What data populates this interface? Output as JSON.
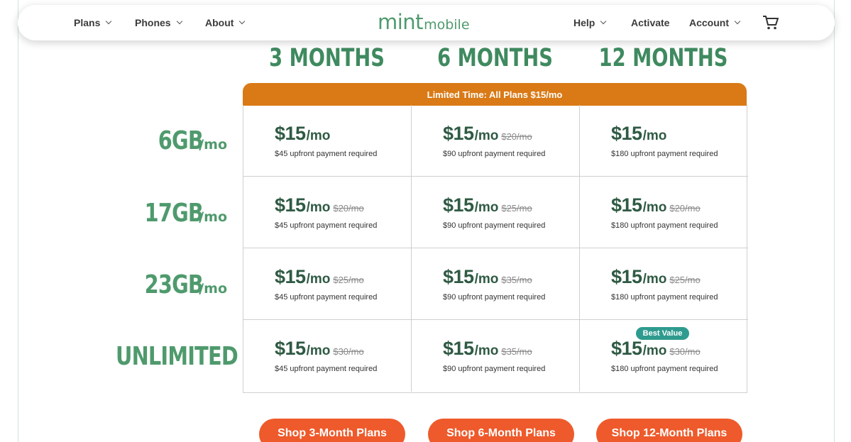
{
  "nav": {
    "left_items": [
      "Plans",
      "Phones",
      "About"
    ],
    "logo": {
      "mint": "mint",
      "mobile": "mobile"
    },
    "right_items": [
      "Help",
      "Activate",
      "Account"
    ],
    "cart_icon": "cart-icon"
  },
  "months": [
    "3 MONTHS",
    "6 MONTHS",
    "12 MONTHS"
  ],
  "banner": "Limited Time: All Plans $15/mo",
  "per_mo": "/mo",
  "rows": [
    {
      "label": "6GB",
      "suffix": "/mo",
      "cells": [
        {
          "price": "$15",
          "old": "",
          "upfront": "$45 upfront payment required"
        },
        {
          "price": "$15",
          "old": "$20/mo",
          "upfront": "$90 upfront payment required"
        },
        {
          "price": "$15",
          "old": "",
          "upfront": "$180 upfront payment required"
        }
      ]
    },
    {
      "label": "17GB",
      "suffix": "/mo",
      "cells": [
        {
          "price": "$15",
          "old": "$20/mo",
          "upfront": "$45 upfront payment required"
        },
        {
          "price": "$15",
          "old": "$25/mo",
          "upfront": "$90 upfront payment required"
        },
        {
          "price": "$15",
          "old": "$20/mo",
          "upfront": "$180 upfront payment required"
        }
      ]
    },
    {
      "label": "23GB",
      "suffix": "/mo",
      "cells": [
        {
          "price": "$15",
          "old": "$25/mo",
          "upfront": "$45 upfront payment required"
        },
        {
          "price": "$15",
          "old": "$35/mo",
          "upfront": "$90 upfront payment required"
        },
        {
          "price": "$15",
          "old": "$25/mo",
          "upfront": "$180 upfront payment required"
        }
      ]
    },
    {
      "label": "UNLIMITED",
      "suffix": "",
      "cells": [
        {
          "price": "$15",
          "old": "$30/mo",
          "upfront": "$45 upfront payment required"
        },
        {
          "price": "$15",
          "old": "$35/mo",
          "upfront": "$90 upfront payment required"
        },
        {
          "price": "$15",
          "old": "$30/mo",
          "upfront": "$180 upfront payment required"
        }
      ]
    }
  ],
  "best_value": "Best Value",
  "buttons": [
    "Shop 3-Month Plans",
    "Shop 6-Month Plans",
    "Shop 12-Month Plans"
  ],
  "colors": {
    "brand_green": "#4f9a6d",
    "price_green": "#2f5a44",
    "banner_orange": "#d97a16",
    "button_orange": "#ee5a2b",
    "badge_teal": "#2f9b8f"
  }
}
